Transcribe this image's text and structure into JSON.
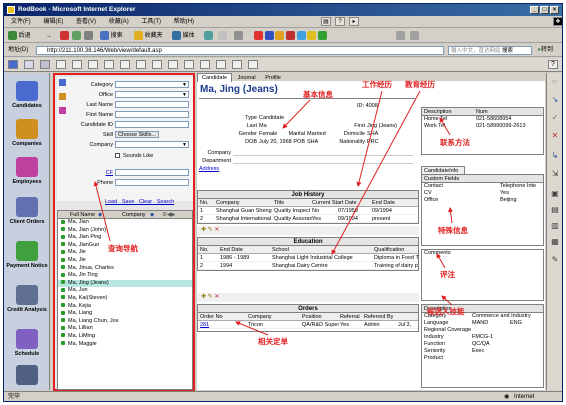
{
  "window": {
    "title": "RedBook - Microsoft Internet Explorer"
  },
  "menu": {
    "items": [
      "文件(F)",
      "编辑(E)",
      "查看(V)",
      "收藏(A)",
      "工具(T)",
      "帮助(H)"
    ]
  },
  "toolbar": {
    "back": "后退",
    "search": "搜索",
    "favorites": "收藏夹",
    "media": "媒体"
  },
  "address": {
    "label": "地址(D)",
    "url": "http://211.100.38.146/Web/view/default.asp",
    "search_placeholder": "输入中文，直达网站",
    "search_button": "搜索",
    "go_label": "转到"
  },
  "left_nav": {
    "items": [
      {
        "label": "Candidates",
        "icon": "people-icon",
        "color": "#4a6ad0"
      },
      {
        "label": "Companies",
        "icon": "buildings-icon",
        "color": "#d09020"
      },
      {
        "label": "Employees",
        "icon": "employees-icon",
        "color": "#c040a0"
      },
      {
        "label": "Client Orders",
        "icon": "orders-icon",
        "color": "#6070b0"
      },
      {
        "label": "Payment Notice",
        "icon": "payment-icon",
        "color": "#40a040"
      },
      {
        "label": "Credit Analysis",
        "icon": "credit-icon",
        "color": "#607090"
      },
      {
        "label": "Schedule",
        "icon": "schedule-icon",
        "color": "#8060c0"
      },
      {
        "label": "",
        "icon": "tools-icon",
        "color": "#506080"
      }
    ]
  },
  "search_form": {
    "fields": [
      {
        "label": "Category",
        "type": "select"
      },
      {
        "label": "Office",
        "type": "select"
      },
      {
        "label": "Last Name",
        "type": "text"
      },
      {
        "label": "First Name",
        "type": "text"
      },
      {
        "label": "Candidate ID",
        "type": "text"
      },
      {
        "label": "Skill",
        "type": "button",
        "value": "Choose Skills..."
      },
      {
        "label": "Company",
        "type": "select"
      },
      {
        "label": "Sounds Like",
        "type": "checkbox"
      },
      {
        "label": "CF",
        "type": "link"
      },
      {
        "label": "Phone",
        "type": "text"
      }
    ],
    "actions": [
      "Load",
      "Save",
      "Clear",
      "Search"
    ]
  },
  "result_list": {
    "headers": [
      "Full Name",
      "Company"
    ],
    "rows": [
      "Ma, Jian",
      "Ma, Jian (John)",
      "Ma, Jian Ping",
      "Ma, JianGuo",
      "Ma, Jie",
      "Ma, Jie",
      "Ma, Jinua, Charles",
      "Ma, Jin Ting",
      "Ma, Jing (Jeans)",
      "Ma, Jun",
      "Ma, Kai(Steven)",
      "Ma, Kejia",
      "Ma, Liang",
      "Ma, Liang Chun, Jos",
      "Ma, Lillian",
      "Ma, LiMing",
      "Ma, Maggie"
    ],
    "selected_index": 8
  },
  "detail": {
    "tabs": [
      "Candidate",
      "Journal",
      "Profile"
    ],
    "name": "Ma, Jing (Jeans)",
    "id_label": "ID:",
    "id": "4008",
    "fields": {
      "type": {
        "label": "Type",
        "value": "Candidate"
      },
      "last": {
        "label": "Last",
        "value": "Ma"
      },
      "first": {
        "label": "First",
        "value": "Jing (Jeans)"
      },
      "gender": {
        "label": "Gender",
        "value": "Female"
      },
      "marital": {
        "label": "Marital",
        "value": "Married"
      },
      "domicile": {
        "label": "Domicile",
        "value": "SHA"
      },
      "dob": {
        "label": "DOB",
        "value": "July 20, 1968"
      },
      "pob": {
        "label": "POB",
        "value": "SHA"
      },
      "nationality": {
        "label": "Nationality",
        "value": "PRC"
      },
      "company": {
        "label": "Company",
        "value": ""
      },
      "department": {
        "label": "Department",
        "value": ""
      },
      "address": {
        "label": "Address",
        "value": ""
      }
    }
  },
  "job_history": {
    "title": "Job History",
    "headers": [
      "No.",
      "Company",
      "Title",
      "Current Start Date",
      "End Date"
    ],
    "rows": [
      [
        "1",
        "Shanghai Guan Sheng",
        "Quality Inspect",
        "No",
        "07/1959",
        "09/1994"
      ],
      [
        "2",
        "Shanghai International",
        "Quality Assuran",
        "Yes",
        "09/1994",
        "present"
      ]
    ]
  },
  "education": {
    "title": "Education",
    "headers": [
      "No.",
      "End Date",
      "School",
      "Qualification"
    ],
    "rows": [
      [
        "1",
        "1986 - 1989",
        "Shanghai Light Industrial College",
        "Diploma in Food T"
      ],
      [
        "2",
        "1994",
        "Shanghai Dairy Centre",
        "Training of dairy p"
      ]
    ]
  },
  "orders": {
    "title": "Orders",
    "headers": [
      "Order No",
      "Company",
      "Position",
      "Referral",
      "Referred By",
      "Status"
    ],
    "rows": [
      [
        "281",
        "Tricon",
        "QA/R&D Super",
        "Yes",
        "Admin",
        "Jul 3,"
      ]
    ]
  },
  "contact_panel": {
    "headers": [
      "Description",
      "Num"
    ],
    "rows": [
      [
        "Home Tel",
        "021-58608954"
      ],
      [
        "Work Tel",
        "021-58990099-2613"
      ]
    ]
  },
  "candidate_info": {
    "tab": "CandidateInfo",
    "header": "Custom Fields",
    "rows": [
      [
        "Contact",
        "Telephone Inte"
      ],
      [
        "CV",
        "Yes"
      ],
      [
        "Office",
        "Beijing"
      ]
    ]
  },
  "comments": {
    "label": "Comments"
  },
  "skills": {
    "header": "Description",
    "rows": [
      [
        "Category",
        "Commerce and Industry"
      ],
      [
        "Language",
        "MAND",
        "ENG"
      ],
      [
        "Regional Coverage",
        ""
      ],
      [
        "Industry",
        "FMCG-1"
      ],
      [
        "Function",
        "QC/QA"
      ],
      [
        "Seniority",
        "Exec"
      ],
      [
        "Product",
        ""
      ]
    ]
  },
  "annotations": {
    "basic_info": "基本信息",
    "work_history": "工作经历",
    "education": "教育经历",
    "contact": "联系方法",
    "special_info": "特殊信息",
    "comments": "评注",
    "candidate_skills": "候选人技能",
    "search_nav": "查询导航",
    "related_orders": "相关定单"
  },
  "status": {
    "left": "完毕",
    "right": "Internet"
  }
}
